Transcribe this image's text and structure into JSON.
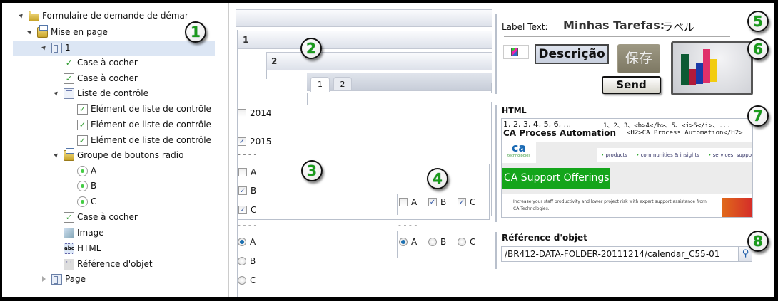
{
  "tree": [
    {
      "label": "Formulaire de demande de démar",
      "icon": "folder",
      "level": 0,
      "expanded": true
    },
    {
      "label": "Mise en page",
      "icon": "folder",
      "level": 1,
      "expanded": true
    },
    {
      "label": "1",
      "icon": "layout",
      "level": 2,
      "expanded": true,
      "selected": true
    },
    {
      "label": "Case à cocher",
      "icon": "check",
      "level": 3
    },
    {
      "label": "Case à cocher",
      "icon": "check",
      "level": 3
    },
    {
      "label": "Liste de contrôle",
      "icon": "list",
      "level": 3,
      "expanded": true
    },
    {
      "label": "Elément de liste de contrôle",
      "icon": "check",
      "level": 4
    },
    {
      "label": "Elément de liste de contrôle",
      "icon": "check",
      "level": 4
    },
    {
      "label": "Elément de liste de contrôle",
      "icon": "check",
      "level": 4
    },
    {
      "label": "Groupe de boutons radio",
      "icon": "folder",
      "level": 3,
      "expanded": true
    },
    {
      "label": "A",
      "icon": "radio",
      "level": 4
    },
    {
      "label": "B",
      "icon": "radio",
      "level": 4
    },
    {
      "label": "C",
      "icon": "radio",
      "level": 4
    },
    {
      "label": "Case à cocher",
      "icon": "check",
      "level": 3
    },
    {
      "label": "Image",
      "icon": "image",
      "level": 3
    },
    {
      "label": "HTML",
      "icon": "html",
      "level": 3
    },
    {
      "label": "Référence d'objet",
      "icon": "ref",
      "level": 3
    },
    {
      "label": "Page",
      "icon": "layout",
      "level": 2,
      "expanded": false
    }
  ],
  "callouts": [
    "1",
    "2",
    "3",
    "4",
    "5",
    "6",
    "7",
    "8"
  ],
  "middle": {
    "panel1": "1",
    "panel2": "2",
    "tabs": [
      "1",
      "2"
    ],
    "years": [
      {
        "label": "2014",
        "checked": false
      },
      {
        "label": "2015",
        "checked": true
      }
    ],
    "dashes": "- - - -",
    "vcheck": [
      {
        "label": "A",
        "checked": false
      },
      {
        "label": "B",
        "checked": true
      },
      {
        "label": "C",
        "checked": true
      }
    ],
    "hcheck": [
      {
        "label": "A",
        "checked": false
      },
      {
        "label": "B",
        "checked": true
      },
      {
        "label": "C",
        "checked": true
      }
    ],
    "vradio": [
      {
        "label": "A",
        "checked": true
      },
      {
        "label": "B",
        "checked": false
      },
      {
        "label": "C",
        "checked": false
      }
    ],
    "hradio": [
      {
        "label": "A",
        "checked": true
      },
      {
        "label": "B",
        "checked": false
      },
      {
        "label": "C",
        "checked": false
      }
    ]
  },
  "right": {
    "label_prefix": "Label Text:",
    "label_pt": "Minhas Tarefas:",
    "label_jp": "ラベル",
    "btn_descricao": "Descrição",
    "btn_save_jp": "保存",
    "btn_send": "Send",
    "html_title": "HTML",
    "html_line1_left": "1, 2, 3, ",
    "html_line1_bold": "4",
    "html_line1_rest": ", 5, 6, ...",
    "html_line1_code": "1、2、3、<b>4</b>、5、<i>6</i>、...",
    "html_line2_left": "CA Process Automation",
    "html_line2_code": "<H2>CA Process Automation</H2>",
    "ca_logo": "ca",
    "ca_logo_sub": "technologies",
    "nav": [
      "products",
      "communities & insights",
      "services, support"
    ],
    "banner": "CA Support Offerings",
    "blurb": "Increase your staff productivity and lower project risk with expert support assistance from CA Technologies.",
    "ref_title": "Référence d'objet",
    "ref_value": "/BR412-DATA-FOLDER-20111214/calendar_C55-01",
    "colors": {
      "accent_green": "#14a51b",
      "save_bg": "#8a8470"
    }
  }
}
